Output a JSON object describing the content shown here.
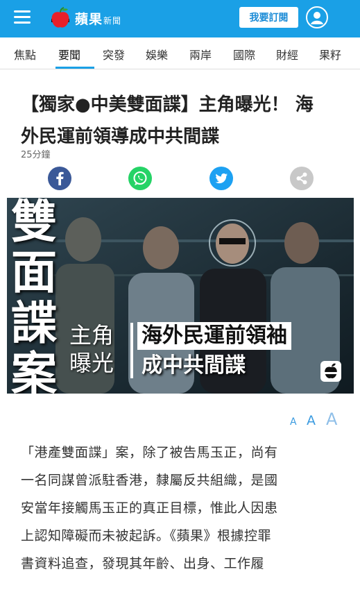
{
  "header": {
    "brand_name": "蘋果",
    "brand_sub": "新聞",
    "subscribe_label": "我要訂閱",
    "accent_color": "#1aa0e6"
  },
  "nav": {
    "items": [
      {
        "label": "焦點"
      },
      {
        "label": "要聞"
      },
      {
        "label": "突發"
      },
      {
        "label": "娛樂"
      },
      {
        "label": "兩岸"
      },
      {
        "label": "國際"
      },
      {
        "label": "財經"
      },
      {
        "label": "果籽"
      }
    ],
    "active_index": 1
  },
  "article": {
    "headline_line1": "【獨家●中美雙面諜】主角曝光！ 海",
    "headline_line2": "外民運前領導成中共間諜",
    "time": "25分鐘",
    "share": [
      {
        "icon": "facebook-icon",
        "color": "#3b5998"
      },
      {
        "icon": "whatsapp-icon",
        "color": "#25d366"
      },
      {
        "icon": "twitter-icon",
        "color": "#1da1f2"
      },
      {
        "icon": "share-icon",
        "color": "#c8c8c8"
      }
    ],
    "hero": {
      "vertical_title": [
        "雙",
        "面",
        "諜",
        "案"
      ],
      "role_line1": "主角",
      "role_line2": "曝光",
      "main_line1": "海外民運前領袖",
      "main_line2": "成中共間諜"
    },
    "font_controls": [
      "A",
      "A",
      "A"
    ],
    "body_lines": [
      "「港產雙面諜」案，除了被告馬玉正，尚有",
      "一名同謀曾派駐香港，隸屬反共組織，是國",
      "安當年接觸馬玉正的真正目標，惟此人因患",
      "上認知障礙而未被起訴。《蘋果》根據控罪",
      "書資料追查，發現其年齡、出身、工作履"
    ]
  }
}
